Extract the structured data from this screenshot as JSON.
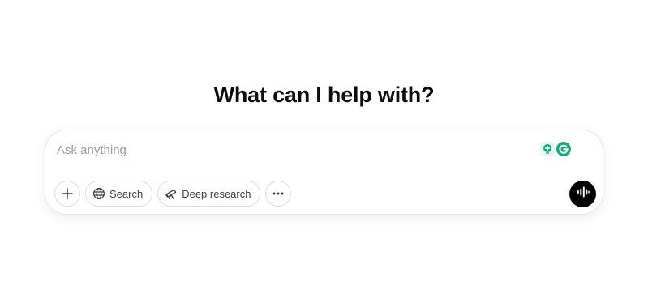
{
  "heading": "What can I help with?",
  "composer": {
    "placeholder": "Ask anything",
    "value": ""
  },
  "toolbar": {
    "add_icon": "plus-icon",
    "search_label": "Search",
    "search_icon": "globe-icon",
    "deep_research_label": "Deep research",
    "deep_research_icon": "telescope-icon",
    "more_icon": "ellipsis-icon",
    "voice_icon": "voice-waveform-icon"
  },
  "extensions": [
    {
      "icon": "lightbulb-plus-icon"
    },
    {
      "icon": "grammarly-g-icon"
    }
  ],
  "colors": {
    "voice_button": "#000000",
    "extension_accent": "#15a87f",
    "border": "#e3e3e3"
  }
}
